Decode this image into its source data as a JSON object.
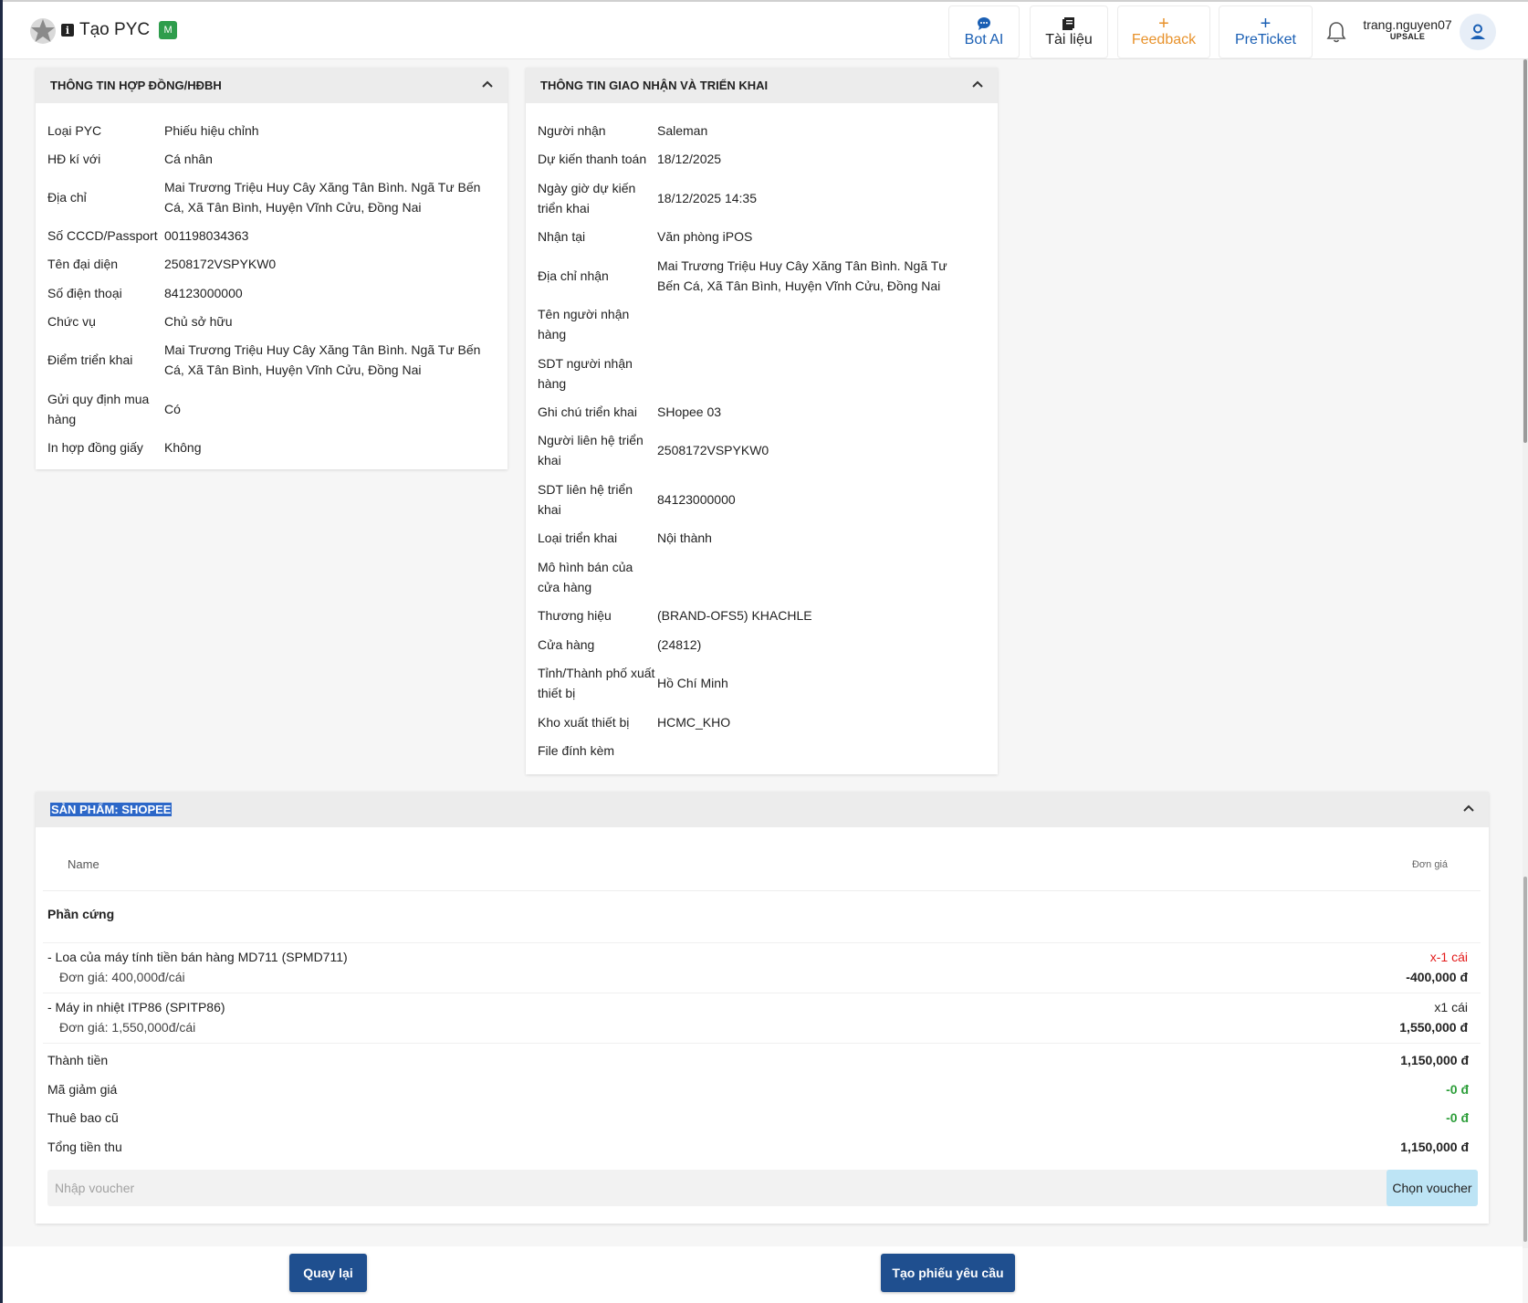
{
  "header": {
    "title": "Tạo PYC",
    "badge": "M",
    "nav": {
      "bot_ai": "Bot AI",
      "tai_lieu": "Tài liệu",
      "feedback": "Feedback",
      "preticket": "PreTicket"
    },
    "user": {
      "name": "trang.nguyen07",
      "role": "UPSALE"
    }
  },
  "contract_panel": {
    "title": "THÔNG TIN HỢP ĐỒNG/HĐBH",
    "rows": [
      {
        "label": "Loại PYC",
        "value": "Phiếu hiệu chỉnh"
      },
      {
        "label": "HĐ kí với",
        "value": "Cá nhân"
      },
      {
        "label": "Địa chỉ",
        "value": "Mai Trương Triệu Huy Cây Xăng Tân Bình. Ngã Tư Bến Cá, Xã Tân Bình, Huyện Vĩnh Cửu, Đồng Nai"
      },
      {
        "label": "Số CCCD/Passport",
        "value": "001198034363"
      },
      {
        "label": "Tên đại diện",
        "value": "2508172VSPYKW0"
      },
      {
        "label": "Số điện thoại",
        "value": "84123000000"
      },
      {
        "label": "Chức vụ",
        "value": "Chủ sở hữu"
      },
      {
        "label": "Điểm triển khai",
        "value": "Mai Trương Triệu Huy Cây Xăng Tân Bình. Ngã Tư Bến Cá, Xã Tân Bình, Huyện Vĩnh Cửu, Đồng Nai"
      },
      {
        "label": "Gửi quy định mua hàng",
        "value": "Có"
      },
      {
        "label": "In hợp đồng giấy",
        "value": "Không"
      }
    ]
  },
  "delivery_panel": {
    "title": "THÔNG TIN GIAO NHẬN VÀ TRIỂN KHAI",
    "rows": [
      {
        "label": "Người nhận",
        "value": "Saleman"
      },
      {
        "label": "Dự kiến thanh toán",
        "value": "18/12/2025"
      },
      {
        "label": "Ngày giờ dự kiến triển khai",
        "value": "18/12/2025 14:35"
      },
      {
        "label": "Nhận tại",
        "value": "Văn phòng iPOS"
      },
      {
        "label": "Địa chỉ nhận",
        "value": "Mai Trương Triệu Huy Cây Xăng Tân Bình. Ngã Tư Bến Cá, Xã Tân Bình, Huyện Vĩnh Cửu, Đồng Nai"
      },
      {
        "label": "Tên người nhận hàng",
        "value": ""
      },
      {
        "label": "SDT người nhận hàng",
        "value": ""
      },
      {
        "label": "Ghi chú triển khai",
        "value": "SHopee 03"
      },
      {
        "label": "Người liên hệ triển khai",
        "value": "2508172VSPYKW0"
      },
      {
        "label": "SDT liên hệ triển khai",
        "value": "84123000000"
      },
      {
        "label": "Loại triển khai",
        "value": "Nội thành"
      },
      {
        "label": "Mô hình bán của cửa hàng",
        "value": ""
      },
      {
        "label": "Thương hiệu",
        "value": "(BRAND-OFS5) KHACHLE"
      },
      {
        "label": "Cửa hàng",
        "value": "(24812)"
      },
      {
        "label": "Tỉnh/Thành phố xuất thiết bị",
        "value": "Hồ Chí Minh"
      },
      {
        "label": "Kho xuất thiết bị",
        "value": "HCMC_KHO"
      },
      {
        "label": "File đính kèm",
        "value": ""
      }
    ]
  },
  "product_panel": {
    "title": "SẢN PHẨM: SHOPEE",
    "col_name": "Name",
    "col_price": "Đơn giá",
    "group": "Phần cứng",
    "items": [
      {
        "name": "- Loa của máy tính tiền bán hàng MD711 (SPMD711)",
        "unit_price": "Đơn giá: 400,000đ/cái",
        "qty": "x-1 cái",
        "total": "-400,000 đ"
      },
      {
        "name": "- Máy in nhiệt ITP86 (SPITP86)",
        "unit_price": "Đơn giá: 1,550,000đ/cái",
        "qty": "x1 cái",
        "total": "1,550,000 đ"
      }
    ],
    "summary": {
      "thanh_tien_label": "Thành tiền",
      "thanh_tien": "1,150,000 đ",
      "ma_giam_gia_label": "Mã giảm giá",
      "ma_giam_gia": "-0 đ",
      "thue_bao_cu_label": "Thuê bao cũ",
      "thue_bao_cu": "-0 đ",
      "tong_tien_label": "Tổng tiền thu",
      "tong_tien": "1,150,000 đ"
    },
    "voucher": {
      "placeholder": "Nhập voucher",
      "value": "",
      "button": "Chọn voucher"
    }
  },
  "footer": {
    "back": "Quay lại",
    "submit": "Tạo phiếu yêu cầu"
  },
  "colors": {
    "primary": "#1f4f8f",
    "accent_blue": "#1a5fb4",
    "feedback_orange": "#e8922b",
    "negative": "#e31b1b",
    "positive": "#2d9e3a",
    "badge_green": "#2e9d4c"
  }
}
